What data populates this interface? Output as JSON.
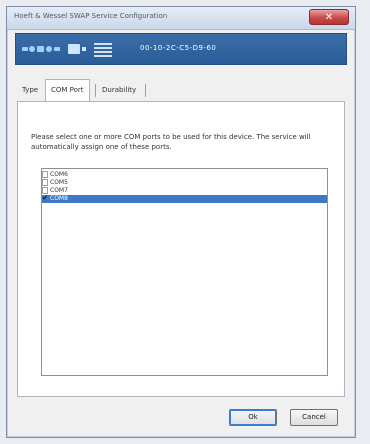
{
  "window": {
    "title": "Hoeft & Wessel SWAP Service Configuration",
    "close_glyph": "✕"
  },
  "banner": {
    "mac_address": "00-10-2C-C5-D9-60",
    "logo_icon": "hw-swap-logo-icon"
  },
  "tabs": [
    {
      "label": "Type",
      "active": false
    },
    {
      "label": "COM Port",
      "active": true
    },
    {
      "label": "Durability",
      "active": false
    }
  ],
  "com_port_tab": {
    "description": "Please select one or more COM ports to be used for this device. The service will automatically assign one of these ports.",
    "ports": [
      {
        "label": "COM6",
        "checked": false,
        "selected": false
      },
      {
        "label": "COM5",
        "checked": false,
        "selected": false
      },
      {
        "label": "COM7",
        "checked": false,
        "selected": false
      },
      {
        "label": "COM8",
        "checked": true,
        "selected": true
      }
    ],
    "check_glyph": "✔"
  },
  "buttons": {
    "ok": "Ok",
    "cancel": "Cancel"
  },
  "colors": {
    "banner": "#2f629e",
    "selection": "#3f78c6",
    "close_button": "#c84a4a"
  }
}
